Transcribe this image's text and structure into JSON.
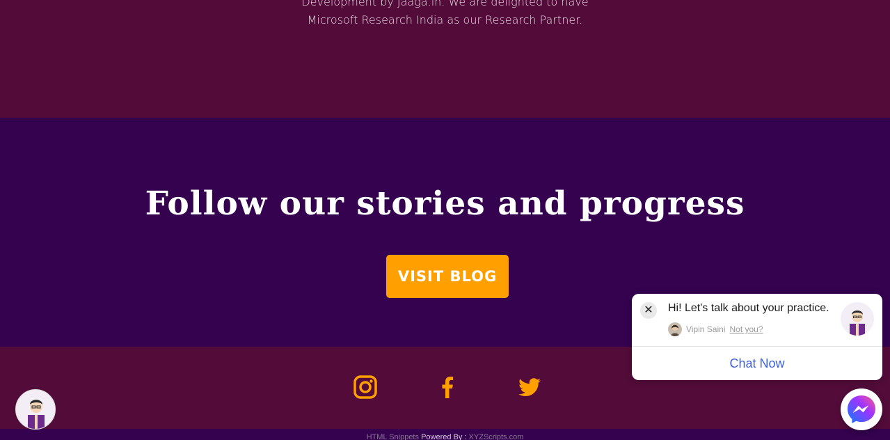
{
  "intro": {
    "line1": "Development by Jaaga.in. We are delighted to have",
    "line2": "Microsoft Research India as our Research Partner."
  },
  "blog": {
    "heading": "Follow our stories and progress",
    "button_label": "VISIT BLOG"
  },
  "social": {
    "icons": [
      "instagram-icon",
      "facebook-icon",
      "twitter-icon"
    ],
    "color": "#ffa000"
  },
  "footer": {
    "left": "HTML Snippets",
    "middle": "Powered By :",
    "right": "XYZScripts.com"
  },
  "chat": {
    "message": "Hi! Let's talk about your practice.",
    "agent_name": "Vipin Saini",
    "not_you": "Not you?",
    "cta": "Chat Now",
    "close_glyph": "✕"
  },
  "colors": {
    "top_bg": "#530c3a",
    "blog_bg": "#34024f",
    "accent": "#ffa000",
    "chat_link": "#3b5fe0"
  }
}
